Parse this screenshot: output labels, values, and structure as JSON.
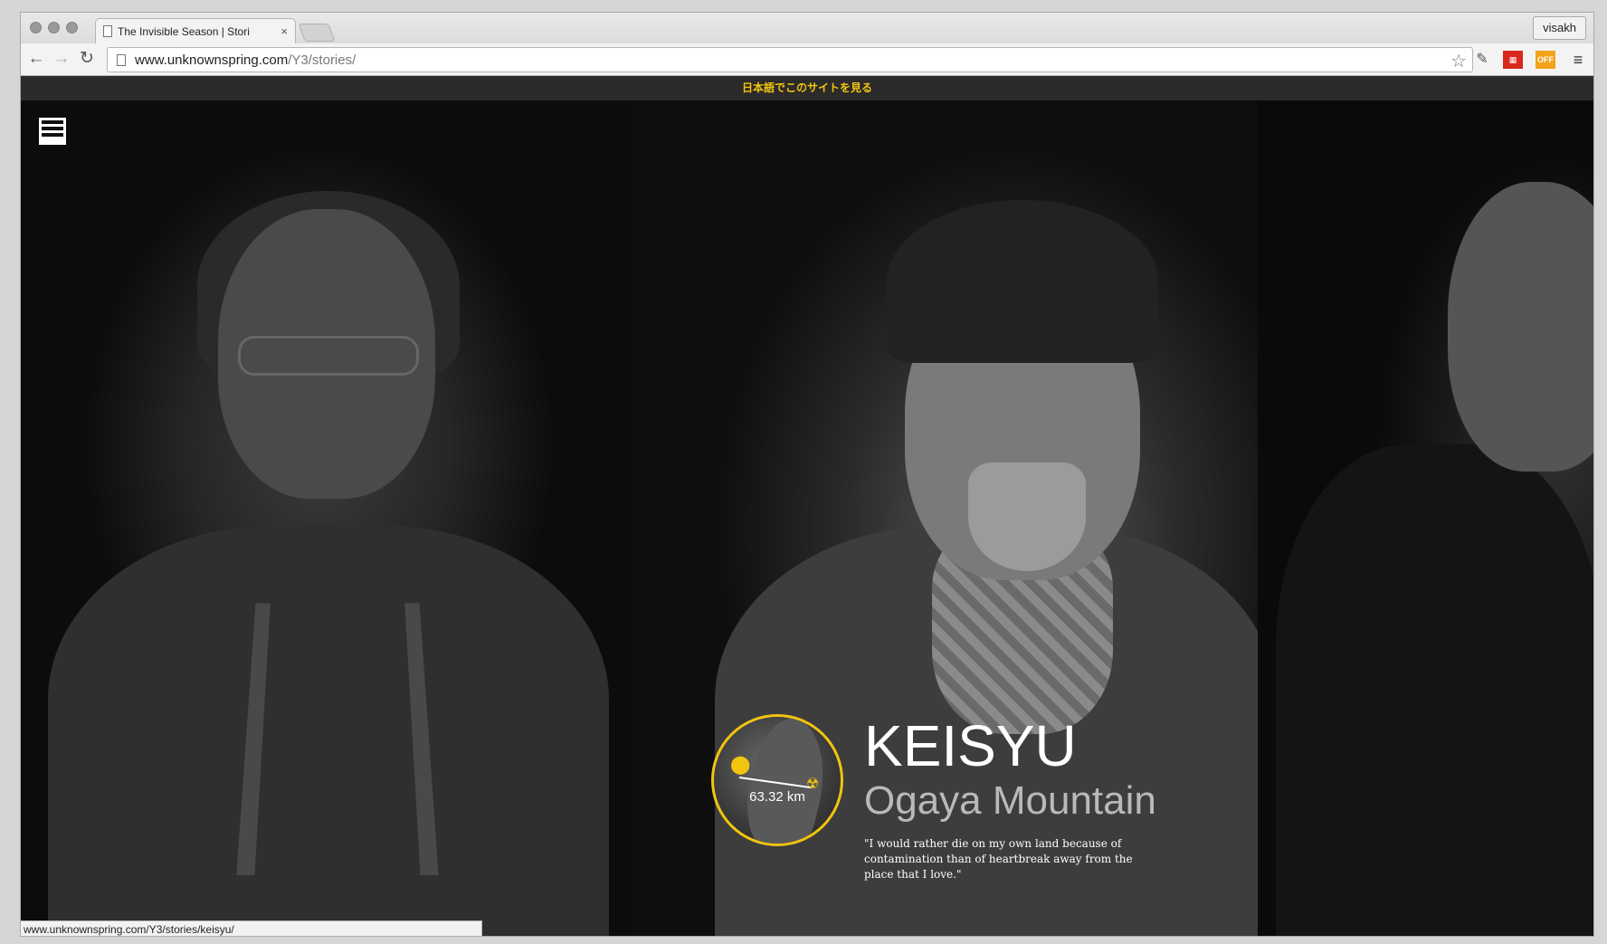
{
  "browser": {
    "tab_title": "The Invisible Season | Stori",
    "tab_close": "×",
    "user_label": "visakh",
    "url_host": "www.unknownspring.com",
    "url_path": "/Y3/stories/",
    "back_glyph": "←",
    "forward_glyph": "→",
    "reload_glyph": "↻",
    "star_glyph": "☆",
    "menu_glyph": "≡",
    "ext_off_label": "OFF",
    "status_url": "www.unknownspring.com/Y3/stories/keisyu/"
  },
  "site": {
    "language_link": "日本語でこのサイトを見る",
    "accent_color": "#f1c40f",
    "story": {
      "name": "KEISYU",
      "place": "Ogaya Mountain",
      "distance": "63.32 km",
      "quote": "\"I would rather die on my own land because of contamination than of heartbreak away from the place that I love.\""
    }
  }
}
